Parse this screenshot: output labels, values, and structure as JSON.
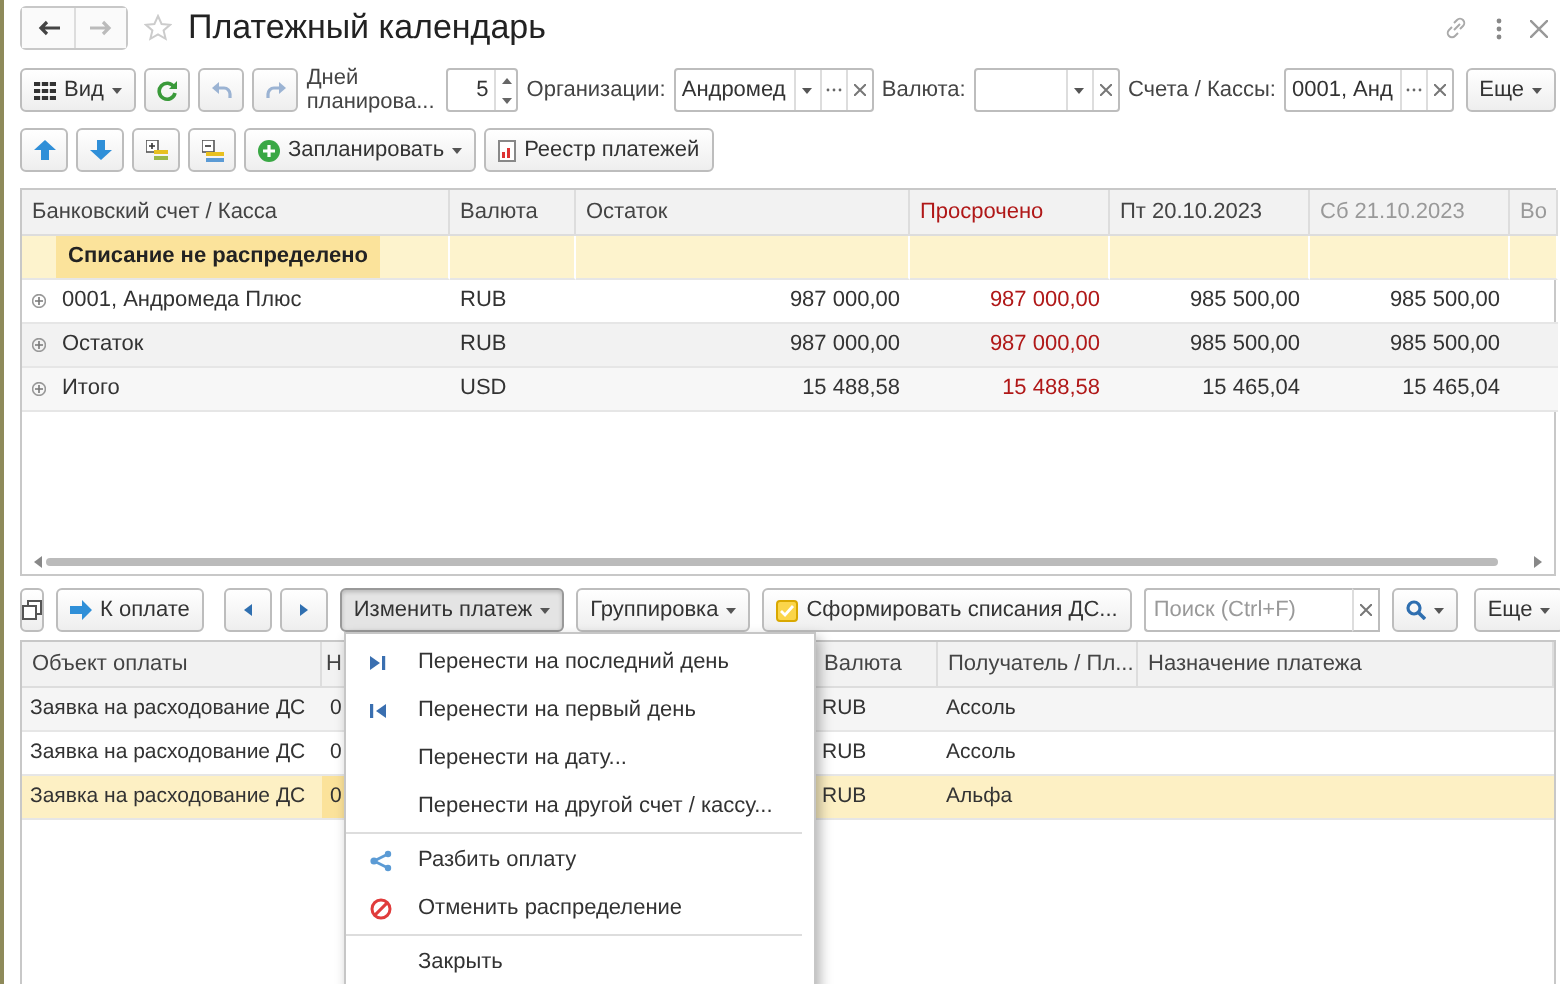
{
  "window": {
    "title": "Платежный календарь"
  },
  "toolbar": {
    "view_button": "Вид",
    "days_label": "Дней планирова...",
    "days_value": "5",
    "org_label": "Организации:",
    "org_value": "Андромед",
    "currency_label": "Валюта:",
    "accounts_label": "Счета / Кассы:",
    "accounts_value": "0001, Анд",
    "more_button": "Еще"
  },
  "actions": {
    "plan_button": "Запланировать",
    "registry_button": "Реестр платежей"
  },
  "balances": {
    "columns": [
      {
        "label": "Банковский счет / Касса",
        "kind": "text"
      },
      {
        "label": "Валюта",
        "kind": "text"
      },
      {
        "label": "Остаток",
        "kind": "amount"
      },
      {
        "label": "Просрочено",
        "kind": "overdue"
      },
      {
        "label": "Пт 20.10.2023",
        "kind": "amount"
      },
      {
        "label": "Сб 21.10.2023",
        "kind": "weekend"
      },
      {
        "label": "Во",
        "kind": "weekend"
      }
    ],
    "group_row": {
      "label": "Списание не распределено"
    },
    "rows": [
      {
        "expandable": true,
        "cells": [
          "0001, Андромеда Плюс",
          "RUB",
          "987 000,00",
          "987 000,00",
          "985 500,00",
          "985 500,00"
        ]
      },
      {
        "expandable": true,
        "cells": [
          "Остаток",
          "RUB",
          "987 000,00",
          "987 000,00",
          "985 500,00",
          "985 500,00"
        ]
      },
      {
        "expandable": true,
        "cells": [
          "Итого",
          "USD",
          "15 488,58",
          "15 488,58",
          "15 465,04",
          "15 465,04"
        ]
      }
    ]
  },
  "payments_toolbar": {
    "pay_button": "К оплате",
    "change_button": {
      "label": "Изменить платеж",
      "pressed": true
    },
    "group_button": "Группировка",
    "form_button": "Сформировать списания ДС...",
    "search": {
      "placeholder": "Поиск (Ctrl+F)"
    },
    "more_button": "Еще"
  },
  "payments": {
    "columns": [
      "Объект оплаты",
      "Н",
      "Валюта",
      "Получатель / Пл...",
      "Назначение платежа"
    ],
    "rows": [
      {
        "selected": false,
        "cells": [
          "Заявка на расходование ДС",
          "0",
          "RUB",
          "Ассоль"
        ]
      },
      {
        "selected": false,
        "cells": [
          "Заявка на расходование ДС",
          "0",
          "RUB",
          "Ассоль"
        ]
      },
      {
        "selected": true,
        "cells": [
          "Заявка на расходование ДС",
          "0",
          "RUB",
          "Альфа"
        ]
      }
    ]
  },
  "menu": {
    "groups": [
      [
        {
          "label": "Перенести на последний день",
          "kind": "last"
        },
        {
          "label": "Перенести на первый день",
          "kind": "first"
        },
        {
          "label": "Перенести на дату...",
          "kind": "plain"
        },
        {
          "label": "Перенести на другой счет / кассу...",
          "kind": "plain"
        }
      ],
      [
        {
          "label": "Разбить оплату",
          "kind": "split"
        },
        {
          "label": "Отменить распределение",
          "kind": "cancel"
        }
      ],
      [
        {
          "label": "Закрыть",
          "kind": "plain"
        }
      ]
    ]
  }
}
